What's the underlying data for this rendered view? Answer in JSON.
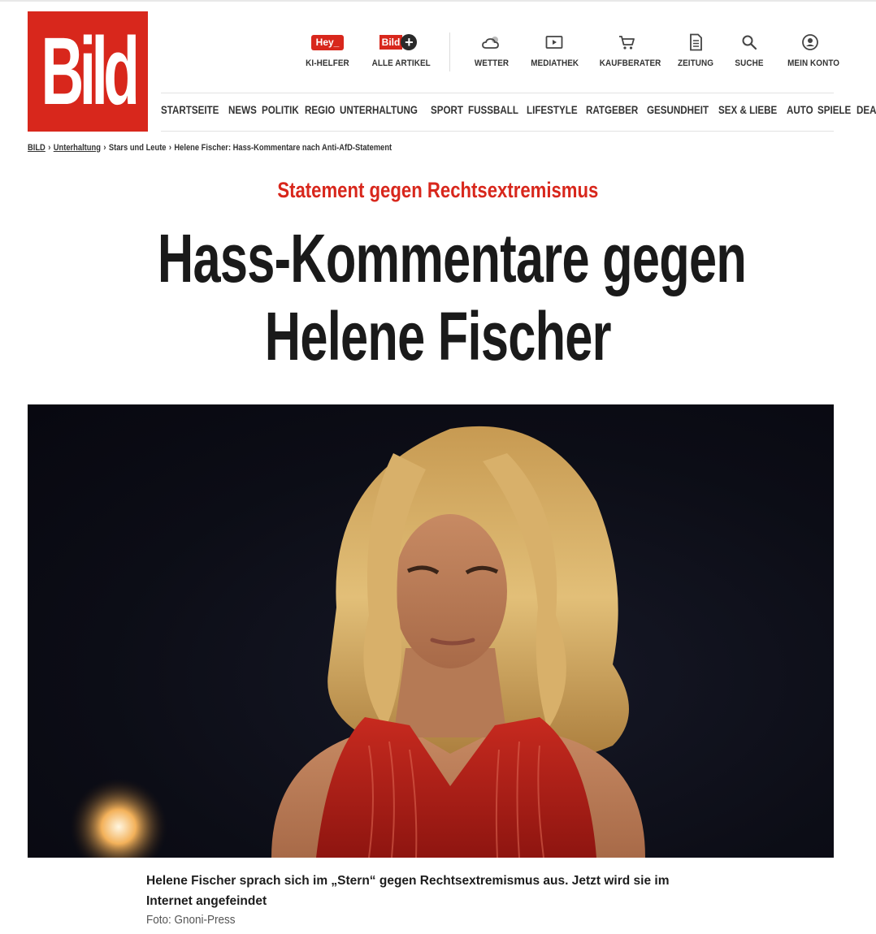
{
  "logo": {
    "text": "Bild"
  },
  "top_actions": [
    {
      "badge": "Hey_",
      "label": "KI-HELFER",
      "icon": "hey-badge-icon"
    },
    {
      "badge": "Bild",
      "badge_plus": "+",
      "label": "ALLE ARTIKEL",
      "icon": "bildplus-icon"
    },
    {
      "label": "WETTER",
      "icon": "cloud-icon"
    },
    {
      "label": "MEDIATHEK",
      "icon": "play-icon"
    },
    {
      "label": "KAUFBERATER",
      "icon": "cart-icon"
    },
    {
      "label": "ZEITUNG",
      "icon": "newspaper-icon"
    },
    {
      "label": "SUCHE",
      "icon": "search-icon"
    },
    {
      "label": "MEIN KONTO",
      "icon": "user-icon"
    }
  ],
  "nav": [
    "STARTSEITE",
    "NEWS",
    "POLITIK",
    "REGIO",
    "UNTERHALTUNG",
    "SPORT",
    "FUSSBALL",
    "LIFESTYLE",
    "RATGEBER",
    "GESUNDHEIT",
    "SEX & LIEBE",
    "AUTO",
    "SPIELE",
    "DEALS"
  ],
  "breadcrumb": {
    "items": [
      "BILD",
      "Unterhaltung",
      "Stars und Leute",
      "Helene Fischer: Hass-Kommentare nach Anti-AfD-Statement"
    ],
    "separator": "›"
  },
  "article": {
    "kicker": "Statement gegen Rechtsextremismus",
    "headline_line1": "Hass-Kommentare gegen",
    "headline_line2": "Helene Fischer",
    "caption": "Helene Fischer sprach sich im „Stern“ gegen Rechtsextremismus aus. Jetzt wird sie im Internet angefeindet",
    "credit": "Foto: Gnoni-Press"
  },
  "colors": {
    "brand_red": "#d8271c",
    "text_dark": "#1a1a1a",
    "muted": "#555555"
  }
}
